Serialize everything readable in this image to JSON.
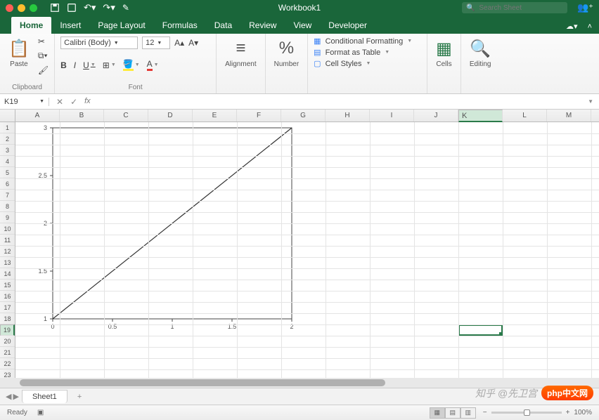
{
  "window": {
    "title": "Workbook1"
  },
  "search": {
    "placeholder": "Search Sheet"
  },
  "tabs": [
    "Home",
    "Insert",
    "Page Layout",
    "Formulas",
    "Data",
    "Review",
    "View",
    "Developer"
  ],
  "active_tab": 0,
  "ribbon": {
    "paste": "Paste",
    "clipboard": "Clipboard",
    "font_name": "Calibri (Body)",
    "font_size": "12",
    "font_label": "Font",
    "bold": "B",
    "italic": "I",
    "underline": "U",
    "alignment": "Alignment",
    "number_fmt": "%",
    "number": "Number",
    "cond_fmt": "Conditional Formatting",
    "as_table": "Format as Table",
    "cell_styles": "Cell Styles",
    "cells": "Cells",
    "editing": "Editing"
  },
  "formula_bar": {
    "cell_ref": "K19",
    "fx": "fx",
    "value": ""
  },
  "columns": [
    "A",
    "B",
    "C",
    "D",
    "E",
    "F",
    "G",
    "H",
    "I",
    "J",
    "K",
    "L",
    "M"
  ],
  "selected_col": "K",
  "rows": [
    1,
    2,
    3,
    4,
    5,
    6,
    7,
    8,
    9,
    10,
    11,
    12,
    13,
    14,
    15,
    16,
    17,
    18,
    19,
    20,
    21,
    22,
    23
  ],
  "selected_row": 19,
  "chart_data": {
    "type": "line",
    "x": [
      0.0,
      2.0
    ],
    "y": [
      1.0,
      3.0
    ],
    "xlim": [
      0.0,
      2.0
    ],
    "ylim": [
      1.0,
      3.0
    ],
    "xticks": [
      0.0,
      0.5,
      1.0,
      1.5,
      2.0
    ],
    "yticks": [
      1.0,
      1.5,
      2.0,
      2.5,
      3.0
    ],
    "title": "",
    "xlabel": "",
    "ylabel": ""
  },
  "sheet": {
    "name": "Sheet1",
    "add": "+"
  },
  "status": {
    "ready": "Ready",
    "zoom": "100%",
    "zoom_pos": 50
  },
  "watermark": {
    "zhihu": "知乎 @先卫宫",
    "php": "php中文网"
  }
}
